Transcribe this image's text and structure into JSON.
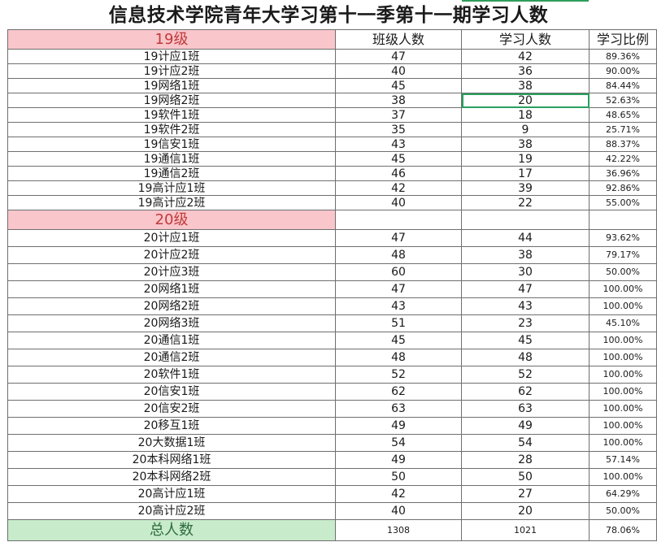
{
  "title": "信息技术学院青年大学习第十一季第十一期学习人数",
  "headers": {
    "grade19": "19级",
    "class_count": "班级人数",
    "study_count": "学习人数",
    "study_ratio": "学习比例"
  },
  "grade19_rows": [
    {
      "name": "19计应1班",
      "total": "47",
      "studied": "42",
      "ratio": "89.36%"
    },
    {
      "name": "19计应2班",
      "total": "40",
      "studied": "36",
      "ratio": "90.00%"
    },
    {
      "name": "19网络1班",
      "total": "45",
      "studied": "38",
      "ratio": "84.44%"
    },
    {
      "name": "19网络2班",
      "total": "38",
      "studied": "20",
      "ratio": "52.63%"
    },
    {
      "name": "19软件1班",
      "total": "37",
      "studied": "18",
      "ratio": "48.65%"
    },
    {
      "name": "19软件2班",
      "total": "35",
      "studied": "9",
      "ratio": "25.71%"
    },
    {
      "name": "19信安1班",
      "total": "43",
      "studied": "38",
      "ratio": "88.37%"
    },
    {
      "name": "19通信1班",
      "total": "45",
      "studied": "19",
      "ratio": "42.22%"
    },
    {
      "name": "19通信2班",
      "total": "46",
      "studied": "17",
      "ratio": "36.96%"
    },
    {
      "name": "19高计应1班",
      "total": "42",
      "studied": "39",
      "ratio": "92.86%"
    },
    {
      "name": "19高计应2班",
      "total": "40",
      "studied": "22",
      "ratio": "55.00%"
    }
  ],
  "grade20_label": "20级",
  "grade20_rows": [
    {
      "name": "20计应1班",
      "total": "47",
      "studied": "44",
      "ratio": "93.62%"
    },
    {
      "name": "20计应2班",
      "total": "48",
      "studied": "38",
      "ratio": "79.17%"
    },
    {
      "name": "20计应3班",
      "total": "60",
      "studied": "30",
      "ratio": "50.00%"
    },
    {
      "name": "20网络1班",
      "total": "47",
      "studied": "47",
      "ratio": "100.00%"
    },
    {
      "name": "20网络2班",
      "total": "43",
      "studied": "43",
      "ratio": "100.00%"
    },
    {
      "name": "20网络3班",
      "total": "51",
      "studied": "23",
      "ratio": "45.10%"
    },
    {
      "name": "20通信1班",
      "total": "45",
      "studied": "45",
      "ratio": "100.00%"
    },
    {
      "name": "20通信2班",
      "total": "48",
      "studied": "48",
      "ratio": "100.00%"
    },
    {
      "name": "20软件1班",
      "total": "52",
      "studied": "52",
      "ratio": "100.00%"
    },
    {
      "name": "20信安1班",
      "total": "62",
      "studied": "62",
      "ratio": "100.00%"
    },
    {
      "name": "20信安2班",
      "total": "63",
      "studied": "63",
      "ratio": "100.00%"
    },
    {
      "name": "20移互1班",
      "total": "49",
      "studied": "49",
      "ratio": "100.00%"
    },
    {
      "name": "20大数据1班",
      "total": "54",
      "studied": "54",
      "ratio": "100.00%"
    },
    {
      "name": "20本科网络1班",
      "total": "49",
      "studied": "28",
      "ratio": "57.14%"
    },
    {
      "name": "20本科网络2班",
      "total": "50",
      "studied": "50",
      "ratio": "100.00%"
    },
    {
      "name": "20高计应1班",
      "total": "42",
      "studied": "27",
      "ratio": "64.29%"
    },
    {
      "name": "20高计应2班",
      "total": "40",
      "studied": "20",
      "ratio": "50.00%"
    }
  ],
  "total": {
    "label": "总人数",
    "total": "1308",
    "studied": "1021",
    "ratio": "78.06%"
  },
  "selected_cell": {
    "row_name": "19网络2班",
    "column": "study_count"
  },
  "colors": {
    "grade_header_bg": "#f8c6cb",
    "grade_header_text": "#c23a3a",
    "total_bg": "#c7ebcb",
    "selection": "#2aa05e"
  }
}
